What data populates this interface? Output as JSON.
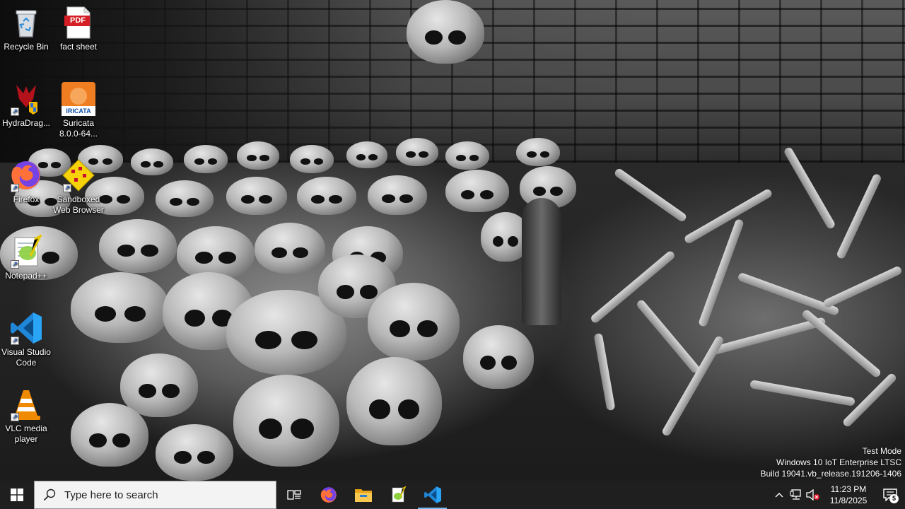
{
  "desktop": {
    "icons": [
      {
        "label": "Recycle Bin",
        "icon": "recycle-bin-icon"
      },
      {
        "label": "fact sheet",
        "icon": "pdf-icon",
        "badge": "PDF"
      },
      {
        "label": "HydraDrag...",
        "icon": "hydradragon-icon"
      },
      {
        "label": "Suricata\n8.0.0-64...",
        "icon": "suricata-icon",
        "badge": "IRICATA"
      },
      {
        "label": "Firefox",
        "icon": "firefox-icon"
      },
      {
        "label": "Sandboxed\nWeb Browser",
        "icon": "sandboxie-icon"
      },
      {
        "label": "Notepad++",
        "icon": "notepadpp-icon"
      },
      {
        "label": "Visual Studio\nCode",
        "icon": "vscode-icon"
      },
      {
        "label": "VLC media\nplayer",
        "icon": "vlc-icon"
      }
    ]
  },
  "watermark": {
    "line1": "Test Mode",
    "line2": "Windows 10 IoT Enterprise LTSC",
    "line3": "Build 19041.vb_release.191206-1406"
  },
  "taskbar": {
    "search_placeholder": "Type here to search",
    "pinned": [
      "task-view",
      "firefox",
      "file-explorer",
      "notepadpp",
      "vscode"
    ],
    "clock": {
      "time": "11:23 PM",
      "date": "11/8/2025"
    },
    "notification_count": "5",
    "colors": {
      "background": "#1f1f1f",
      "accent": "#76b9ed"
    }
  }
}
